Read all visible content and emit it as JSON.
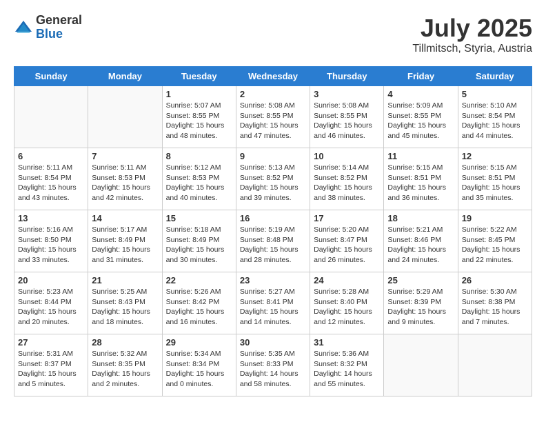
{
  "header": {
    "logo_general": "General",
    "logo_blue": "Blue",
    "month": "July 2025",
    "location": "Tillmitsch, Styria, Austria"
  },
  "days_of_week": [
    "Sunday",
    "Monday",
    "Tuesday",
    "Wednesday",
    "Thursday",
    "Friday",
    "Saturday"
  ],
  "weeks": [
    [
      {
        "day": "",
        "sunrise": "",
        "sunset": "",
        "daylight": "",
        "empty": true
      },
      {
        "day": "",
        "sunrise": "",
        "sunset": "",
        "daylight": "",
        "empty": true
      },
      {
        "day": "1",
        "sunrise": "Sunrise: 5:07 AM",
        "sunset": "Sunset: 8:55 PM",
        "daylight": "Daylight: 15 hours and 48 minutes.",
        "empty": false
      },
      {
        "day": "2",
        "sunrise": "Sunrise: 5:08 AM",
        "sunset": "Sunset: 8:55 PM",
        "daylight": "Daylight: 15 hours and 47 minutes.",
        "empty": false
      },
      {
        "day": "3",
        "sunrise": "Sunrise: 5:08 AM",
        "sunset": "Sunset: 8:55 PM",
        "daylight": "Daylight: 15 hours and 46 minutes.",
        "empty": false
      },
      {
        "day": "4",
        "sunrise": "Sunrise: 5:09 AM",
        "sunset": "Sunset: 8:55 PM",
        "daylight": "Daylight: 15 hours and 45 minutes.",
        "empty": false
      },
      {
        "day": "5",
        "sunrise": "Sunrise: 5:10 AM",
        "sunset": "Sunset: 8:54 PM",
        "daylight": "Daylight: 15 hours and 44 minutes.",
        "empty": false
      }
    ],
    [
      {
        "day": "6",
        "sunrise": "Sunrise: 5:11 AM",
        "sunset": "Sunset: 8:54 PM",
        "daylight": "Daylight: 15 hours and 43 minutes.",
        "empty": false
      },
      {
        "day": "7",
        "sunrise": "Sunrise: 5:11 AM",
        "sunset": "Sunset: 8:53 PM",
        "daylight": "Daylight: 15 hours and 42 minutes.",
        "empty": false
      },
      {
        "day": "8",
        "sunrise": "Sunrise: 5:12 AM",
        "sunset": "Sunset: 8:53 PM",
        "daylight": "Daylight: 15 hours and 40 minutes.",
        "empty": false
      },
      {
        "day": "9",
        "sunrise": "Sunrise: 5:13 AM",
        "sunset": "Sunset: 8:52 PM",
        "daylight": "Daylight: 15 hours and 39 minutes.",
        "empty": false
      },
      {
        "day": "10",
        "sunrise": "Sunrise: 5:14 AM",
        "sunset": "Sunset: 8:52 PM",
        "daylight": "Daylight: 15 hours and 38 minutes.",
        "empty": false
      },
      {
        "day": "11",
        "sunrise": "Sunrise: 5:15 AM",
        "sunset": "Sunset: 8:51 PM",
        "daylight": "Daylight: 15 hours and 36 minutes.",
        "empty": false
      },
      {
        "day": "12",
        "sunrise": "Sunrise: 5:15 AM",
        "sunset": "Sunset: 8:51 PM",
        "daylight": "Daylight: 15 hours and 35 minutes.",
        "empty": false
      }
    ],
    [
      {
        "day": "13",
        "sunrise": "Sunrise: 5:16 AM",
        "sunset": "Sunset: 8:50 PM",
        "daylight": "Daylight: 15 hours and 33 minutes.",
        "empty": false
      },
      {
        "day": "14",
        "sunrise": "Sunrise: 5:17 AM",
        "sunset": "Sunset: 8:49 PM",
        "daylight": "Daylight: 15 hours and 31 minutes.",
        "empty": false
      },
      {
        "day": "15",
        "sunrise": "Sunrise: 5:18 AM",
        "sunset": "Sunset: 8:49 PM",
        "daylight": "Daylight: 15 hours and 30 minutes.",
        "empty": false
      },
      {
        "day": "16",
        "sunrise": "Sunrise: 5:19 AM",
        "sunset": "Sunset: 8:48 PM",
        "daylight": "Daylight: 15 hours and 28 minutes.",
        "empty": false
      },
      {
        "day": "17",
        "sunrise": "Sunrise: 5:20 AM",
        "sunset": "Sunset: 8:47 PM",
        "daylight": "Daylight: 15 hours and 26 minutes.",
        "empty": false
      },
      {
        "day": "18",
        "sunrise": "Sunrise: 5:21 AM",
        "sunset": "Sunset: 8:46 PM",
        "daylight": "Daylight: 15 hours and 24 minutes.",
        "empty": false
      },
      {
        "day": "19",
        "sunrise": "Sunrise: 5:22 AM",
        "sunset": "Sunset: 8:45 PM",
        "daylight": "Daylight: 15 hours and 22 minutes.",
        "empty": false
      }
    ],
    [
      {
        "day": "20",
        "sunrise": "Sunrise: 5:23 AM",
        "sunset": "Sunset: 8:44 PM",
        "daylight": "Daylight: 15 hours and 20 minutes.",
        "empty": false
      },
      {
        "day": "21",
        "sunrise": "Sunrise: 5:25 AM",
        "sunset": "Sunset: 8:43 PM",
        "daylight": "Daylight: 15 hours and 18 minutes.",
        "empty": false
      },
      {
        "day": "22",
        "sunrise": "Sunrise: 5:26 AM",
        "sunset": "Sunset: 8:42 PM",
        "daylight": "Daylight: 15 hours and 16 minutes.",
        "empty": false
      },
      {
        "day": "23",
        "sunrise": "Sunrise: 5:27 AM",
        "sunset": "Sunset: 8:41 PM",
        "daylight": "Daylight: 15 hours and 14 minutes.",
        "empty": false
      },
      {
        "day": "24",
        "sunrise": "Sunrise: 5:28 AM",
        "sunset": "Sunset: 8:40 PM",
        "daylight": "Daylight: 15 hours and 12 minutes.",
        "empty": false
      },
      {
        "day": "25",
        "sunrise": "Sunrise: 5:29 AM",
        "sunset": "Sunset: 8:39 PM",
        "daylight": "Daylight: 15 hours and 9 minutes.",
        "empty": false
      },
      {
        "day": "26",
        "sunrise": "Sunrise: 5:30 AM",
        "sunset": "Sunset: 8:38 PM",
        "daylight": "Daylight: 15 hours and 7 minutes.",
        "empty": false
      }
    ],
    [
      {
        "day": "27",
        "sunrise": "Sunrise: 5:31 AM",
        "sunset": "Sunset: 8:37 PM",
        "daylight": "Daylight: 15 hours and 5 minutes.",
        "empty": false
      },
      {
        "day": "28",
        "sunrise": "Sunrise: 5:32 AM",
        "sunset": "Sunset: 8:35 PM",
        "daylight": "Daylight: 15 hours and 2 minutes.",
        "empty": false
      },
      {
        "day": "29",
        "sunrise": "Sunrise: 5:34 AM",
        "sunset": "Sunset: 8:34 PM",
        "daylight": "Daylight: 15 hours and 0 minutes.",
        "empty": false
      },
      {
        "day": "30",
        "sunrise": "Sunrise: 5:35 AM",
        "sunset": "Sunset: 8:33 PM",
        "daylight": "Daylight: 14 hours and 58 minutes.",
        "empty": false
      },
      {
        "day": "31",
        "sunrise": "Sunrise: 5:36 AM",
        "sunset": "Sunset: 8:32 PM",
        "daylight": "Daylight: 14 hours and 55 minutes.",
        "empty": false
      },
      {
        "day": "",
        "sunrise": "",
        "sunset": "",
        "daylight": "",
        "empty": true
      },
      {
        "day": "",
        "sunrise": "",
        "sunset": "",
        "daylight": "",
        "empty": true
      }
    ]
  ]
}
